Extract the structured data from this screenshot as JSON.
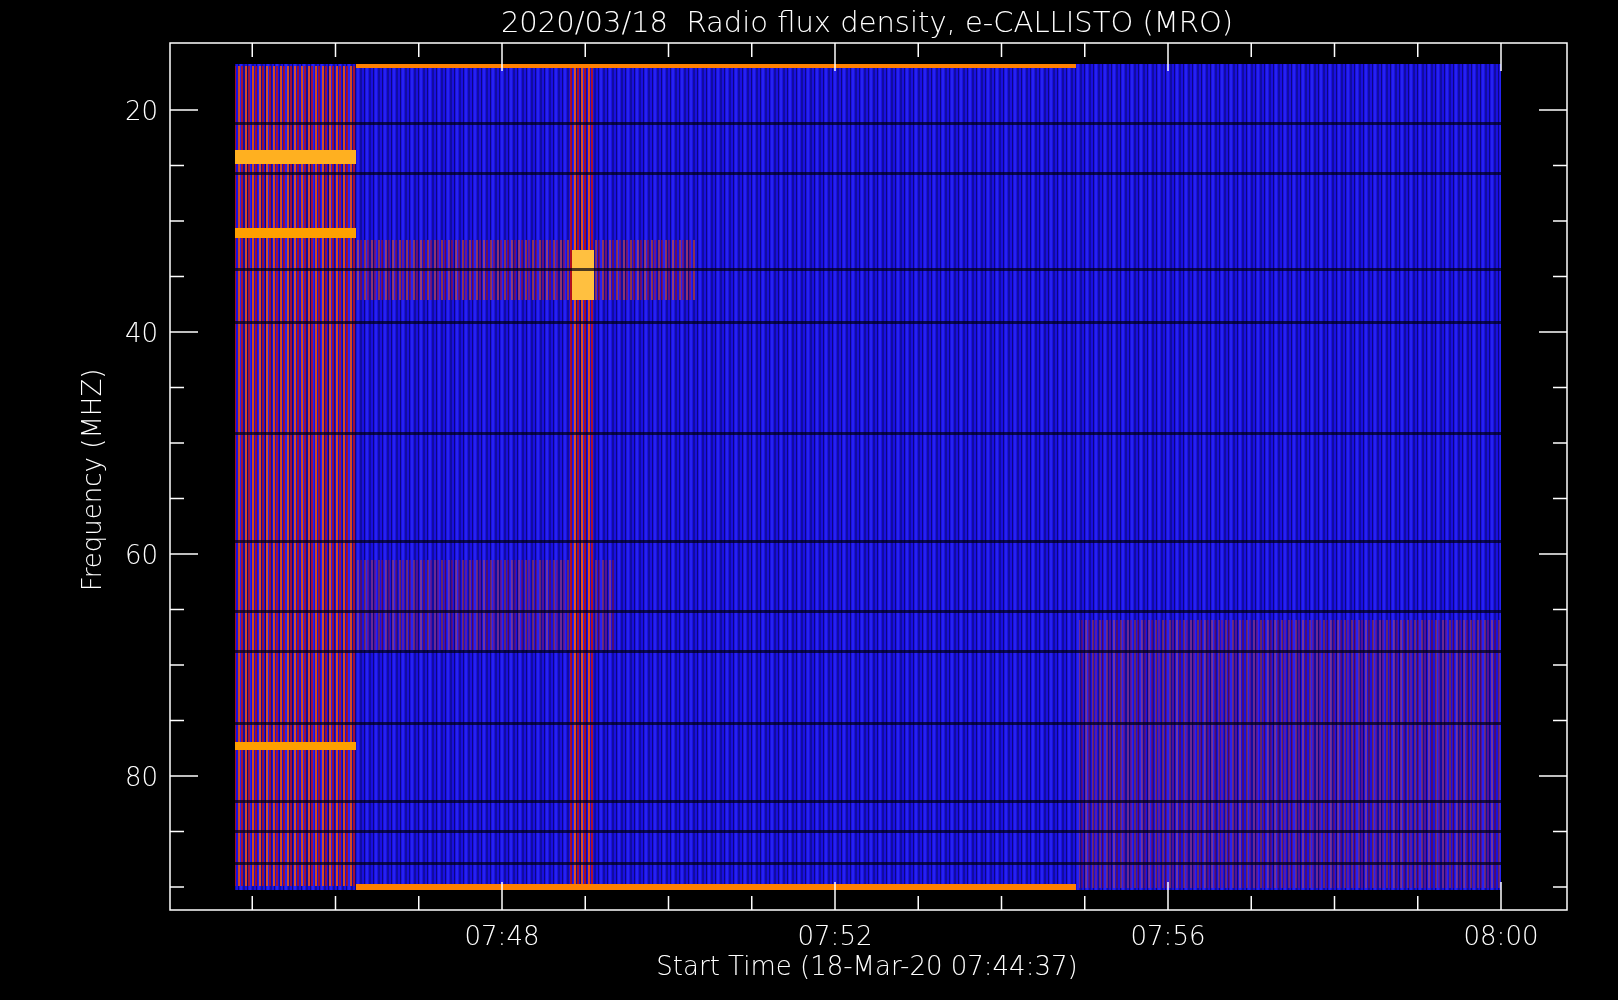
{
  "title": "2020/03/18  Radio flux density, e-CALLISTO (MRO)",
  "y_axis": {
    "label": "Frequency (MHZ)",
    "ticks": [
      "20",
      "40",
      "60",
      "80"
    ]
  },
  "x_axis": {
    "label": "Start Time (18-Mar-20 07:44:37)",
    "ticks": [
      "07:48",
      "07:52",
      "07:56",
      "08:00"
    ]
  }
}
